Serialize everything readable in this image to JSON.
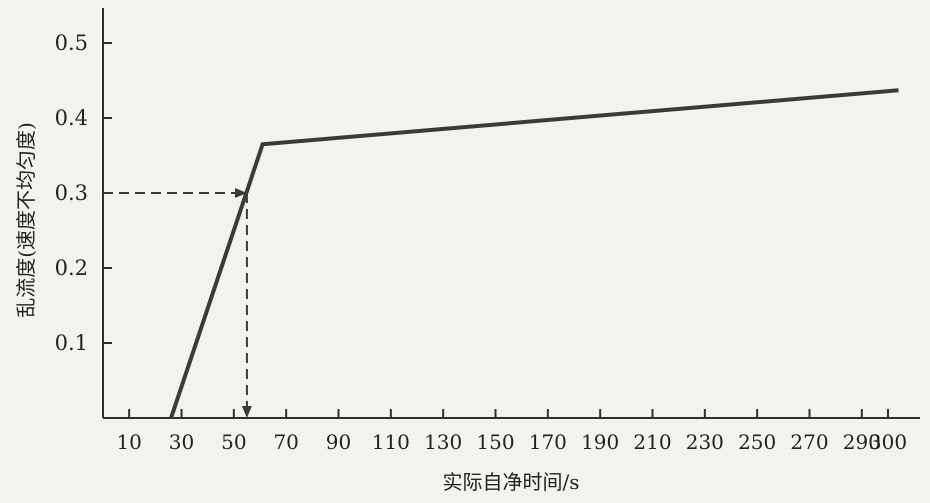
{
  "chart_data": {
    "type": "line",
    "xlabel": "实际自净时间/s",
    "ylabel": "乱流度(速度不均匀度)",
    "x_ticks": [
      10,
      30,
      50,
      70,
      90,
      110,
      130,
      150,
      170,
      190,
      210,
      230,
      250,
      270,
      290,
      300
    ],
    "x_tick_labels": [
      "10",
      "30",
      "50",
      "70",
      "90",
      "110",
      "130",
      "150",
      "170",
      "190",
      "210",
      "230",
      "250",
      "270",
      "290",
      "300"
    ],
    "y_labeled_ticks": [
      0.1,
      0.2,
      0.3,
      0.4,
      0.5
    ],
    "y_tick_labels": [
      "0.1",
      "0.2",
      "0.3",
      "0.4",
      "0.5"
    ],
    "y_unlabeled_ticks": [
      0.6,
      0.7,
      0.8,
      0.9,
      1.0,
      1.1
    ],
    "xlim": [
      0,
      304
    ],
    "ylim": [
      0,
      1.2
    ],
    "grid": false,
    "series": [
      {
        "points": [
          {
            "x": 26,
            "y": 0.0
          },
          {
            "x": 61,
            "y": 0.365
          },
          {
            "x": 304,
            "y": 0.437
          }
        ],
        "color": "#3a3a3a"
      }
    ],
    "annotations": [
      {
        "type": "dashed-arrow-guide",
        "from": {
          "x": 0,
          "y": 0.3
        },
        "corner": {
          "x": 55,
          "y": 0.3
        },
        "to": {
          "x": 55,
          "y": 0.0
        },
        "color": "#3a3a3a"
      }
    ]
  }
}
